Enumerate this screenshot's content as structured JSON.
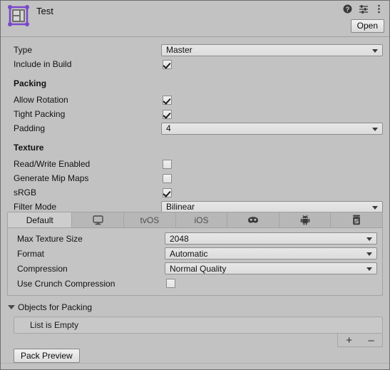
{
  "window": {
    "title": "Test",
    "icon": "sprite-atlas-icon",
    "bg_color": "#c2c2c2"
  },
  "header": {
    "title": "Test",
    "open_label": "Open",
    "icons": [
      {
        "name": "help-icon",
        "glyph": "?"
      },
      {
        "name": "preset-icon",
        "glyph": "sliders"
      },
      {
        "name": "more-menu-icon",
        "glyph": "kebab"
      }
    ]
  },
  "properties": {
    "type": {
      "label": "Type",
      "value": "Master"
    },
    "include_in_build": {
      "label": "Include in Build",
      "checked": true
    },
    "packing_header": "Packing",
    "allow_rotation": {
      "label": "Allow Rotation",
      "checked": true
    },
    "tight_packing": {
      "label": "Tight Packing",
      "checked": true
    },
    "padding": {
      "label": "Padding",
      "value": "4"
    },
    "texture_header": "Texture",
    "read_write_enabled": {
      "label": "Read/Write Enabled",
      "checked": false
    },
    "generate_mip_maps": {
      "label": "Generate Mip Maps",
      "checked": false
    },
    "srgb": {
      "label": "sRGB",
      "checked": true
    },
    "filter_mode": {
      "label": "Filter Mode",
      "value": "Bilinear"
    }
  },
  "platform_tabs": {
    "selected": "Default",
    "items": [
      {
        "label": "Default",
        "icon": null,
        "selected": true,
        "dimmed": false
      },
      {
        "label": "",
        "icon": "standalone-monitor-icon",
        "selected": false,
        "dimmed": false
      },
      {
        "label": "tvOS",
        "icon": null,
        "selected": false,
        "dimmed": true
      },
      {
        "label": "iOS",
        "icon": null,
        "selected": false,
        "dimmed": true
      },
      {
        "label": "",
        "icon": "visionos-icon",
        "selected": false,
        "dimmed": false
      },
      {
        "label": "",
        "icon": "android-icon",
        "selected": false,
        "dimmed": false
      },
      {
        "label": "",
        "icon": "webgl-icon",
        "selected": false,
        "dimmed": false
      }
    ]
  },
  "platform_settings": {
    "max_texture_size": {
      "label": "Max Texture Size",
      "value": "2048"
    },
    "format": {
      "label": "Format",
      "value": "Automatic"
    },
    "compression": {
      "label": "Compression",
      "value": "Normal Quality"
    },
    "use_crunch_compression": {
      "label": "Use Crunch Compression",
      "checked": false
    }
  },
  "objects_for_packing": {
    "label": "Objects for Packing",
    "expanded": true,
    "empty_text": "List is Empty",
    "add_label": "+",
    "remove_label": "–"
  },
  "footer": {
    "pack_preview_label": "Pack Preview"
  }
}
